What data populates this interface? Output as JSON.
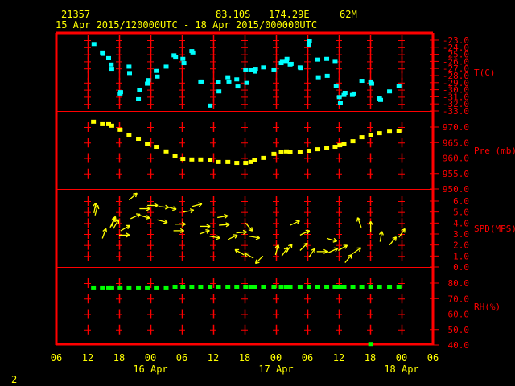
{
  "header": {
    "station": "21357",
    "latitude": "83.10S",
    "longitude": "174.29E",
    "elevation": "62M",
    "period": "15 Apr 2015/120000UTC - 18 Apr 2015/000000UTC"
  },
  "page_number": "2",
  "colors": {
    "frame": "#ff0000",
    "text": "#ffff00",
    "temperature": "#00ffff",
    "pressure": "#ffff00",
    "wind": "#ffff00",
    "rh": "#00ff00"
  },
  "chart_data": {
    "type": "scatter",
    "title": "21357 83.10S 174.29E 62M",
    "subtitle": "15 Apr 2015/120000UTC - 18 Apr 2015/000000UTC",
    "x_units": "hours since 15 Apr 2015 06UTC",
    "x_range": [
      0,
      72
    ],
    "x_tick_labels": [
      "06",
      "12",
      "18",
      "00",
      "06",
      "12",
      "18",
      "00",
      "06",
      "12",
      "18",
      "00",
      "06"
    ],
    "date_labels": [
      {
        "label": "16 Apr",
        "hour": 18
      },
      {
        "label": "17 Apr",
        "hour": 42
      },
      {
        "label": "18 Apr",
        "hour": 66
      }
    ],
    "grid": true,
    "panels": [
      {
        "name": "temperature",
        "label": "T(C)",
        "range": [
          -33,
          -23
        ],
        "tick_labels": [
          "-23.0",
          "-24.0",
          "-25.0",
          "-26.0",
          "-27.0",
          "-28.0",
          "-29.0",
          "-30.0",
          "-31.0",
          "-32.0",
          "-33.0"
        ],
        "points": [
          [
            7.2,
            -23.6
          ],
          [
            8.8,
            -24.8
          ],
          [
            8.9,
            -25.0
          ],
          [
            10.0,
            -25.6
          ],
          [
            10.5,
            -26.5
          ],
          [
            10.6,
            -27.1
          ],
          [
            12.3,
            -30.4
          ],
          [
            12.2,
            -30.6
          ],
          [
            13.9,
            -26.8
          ],
          [
            14.0,
            -27.7
          ],
          [
            15.9,
            -30.1
          ],
          [
            15.7,
            -31.4
          ],
          [
            17.6,
            -28.7
          ],
          [
            17.4,
            -29.2
          ],
          [
            19.1,
            -27.4
          ],
          [
            19.3,
            -28.2
          ],
          [
            21.0,
            -26.8
          ],
          [
            22.5,
            -25.2
          ],
          [
            22.8,
            -25.4
          ],
          [
            24.2,
            -25.7
          ],
          [
            24.4,
            -26.3
          ],
          [
            25.9,
            -24.6
          ],
          [
            26.1,
            -24.8
          ],
          [
            27.6,
            -28.9
          ],
          [
            27.8,
            -28.9
          ],
          [
            29.4,
            -32.3
          ],
          [
            31.0,
            -29.0
          ],
          [
            31.1,
            -30.3
          ],
          [
            32.8,
            -28.3
          ],
          [
            33.0,
            -28.9
          ],
          [
            34.5,
            -28.6
          ],
          [
            34.7,
            -29.6
          ],
          [
            36.2,
            -27.2
          ],
          [
            36.4,
            -29.1
          ],
          [
            37.2,
            -27.3
          ],
          [
            38.0,
            -27.5
          ],
          [
            38.1,
            -27.1
          ],
          [
            39.6,
            -26.9
          ],
          [
            41.6,
            -27.2
          ],
          [
            43.0,
            -26.3
          ],
          [
            43.2,
            -26.0
          ],
          [
            44.0,
            -26.0
          ],
          [
            44.1,
            -25.7
          ],
          [
            44.7,
            -26.5
          ],
          [
            44.9,
            -26.4
          ],
          [
            46.6,
            -26.9
          ],
          [
            46.7,
            -27.0
          ],
          [
            48.3,
            -23.7
          ],
          [
            48.4,
            -23.2
          ],
          [
            50.0,
            -25.8
          ],
          [
            50.1,
            -28.3
          ],
          [
            51.7,
            -25.7
          ],
          [
            51.8,
            -28.1
          ],
          [
            53.3,
            -26.0
          ],
          [
            53.5,
            -29.5
          ],
          [
            54.1,
            -31.1
          ],
          [
            54.3,
            -31.9
          ],
          [
            55.0,
            -30.8
          ],
          [
            55.2,
            -30.5
          ],
          [
            56.6,
            -30.8
          ],
          [
            56.9,
            -30.6
          ],
          [
            58.4,
            -28.8
          ],
          [
            60.1,
            -28.9
          ],
          [
            60.3,
            -29.2
          ],
          [
            61.8,
            -31.3
          ],
          [
            62.0,
            -31.5
          ],
          [
            63.7,
            -30.3
          ],
          [
            65.5,
            -29.5
          ]
        ]
      },
      {
        "name": "pressure",
        "label": "Pre (mb)",
        "range": [
          950,
          970
        ],
        "tick_labels": [
          "970.0",
          "965.0",
          "960.0",
          "955.0",
          "950.0"
        ],
        "points": [
          [
            7.1,
            971.6
          ],
          [
            8.8,
            970.8
          ],
          [
            10.0,
            970.8
          ],
          [
            10.6,
            970.3
          ],
          [
            12.2,
            969.0
          ],
          [
            13.9,
            967.4
          ],
          [
            15.7,
            966.1
          ],
          [
            17.4,
            964.5
          ],
          [
            19.1,
            963.5
          ],
          [
            21.0,
            962.0
          ],
          [
            22.7,
            960.4
          ],
          [
            24.2,
            959.6
          ],
          [
            25.9,
            959.4
          ],
          [
            27.6,
            959.4
          ],
          [
            29.4,
            959.1
          ],
          [
            31.0,
            958.6
          ],
          [
            32.8,
            958.6
          ],
          [
            34.5,
            958.3
          ],
          [
            36.2,
            958.3
          ],
          [
            37.2,
            958.6
          ],
          [
            37.9,
            959.1
          ],
          [
            39.6,
            959.9
          ],
          [
            41.6,
            961.2
          ],
          [
            43.0,
            961.7
          ],
          [
            44.0,
            962.0
          ],
          [
            44.7,
            961.7
          ],
          [
            46.6,
            961.7
          ],
          [
            48.3,
            962.2
          ],
          [
            50.0,
            962.7
          ],
          [
            51.7,
            963.0
          ],
          [
            53.3,
            963.5
          ],
          [
            54.2,
            964.0
          ],
          [
            55.0,
            964.3
          ],
          [
            56.7,
            965.3
          ],
          [
            58.4,
            966.6
          ],
          [
            60.1,
            967.4
          ],
          [
            61.8,
            967.9
          ],
          [
            63.7,
            968.4
          ],
          [
            65.5,
            968.7
          ]
        ]
      },
      {
        "name": "wind",
        "label": "SPD(MPS)",
        "range": [
          0,
          6
        ],
        "tick_labels": [
          "6.0",
          "5.0",
          "4.0",
          "3.0",
          "2.0",
          "1.0",
          "0.0"
        ],
        "arrows_note": "each: [hour, speed, direction_deg (0=right,90=up)]",
        "arrows": [
          [
            7.2,
            4.9,
            80
          ],
          [
            7.4,
            4.7,
            75
          ],
          [
            8.8,
            2.6,
            70
          ],
          [
            10.3,
            3.6,
            65
          ],
          [
            10.6,
            3.7,
            70
          ],
          [
            10.9,
            3.5,
            60
          ],
          [
            12.3,
            3.3,
            30
          ],
          [
            12.0,
            2.9,
            0
          ],
          [
            13.9,
            6.1,
            40
          ],
          [
            14.2,
            4.4,
            25
          ],
          [
            15.9,
            5.3,
            0
          ],
          [
            15.9,
            4.7,
            -15
          ],
          [
            17.4,
            5.6,
            0
          ],
          [
            19.5,
            5.5,
            -5
          ],
          [
            21.0,
            5.5,
            -15
          ],
          [
            19.3,
            4.3,
            -15
          ],
          [
            24.3,
            5.0,
            10
          ],
          [
            25.9,
            5.5,
            15
          ],
          [
            22.7,
            3.9,
            0
          ],
          [
            22.4,
            3.3,
            0
          ],
          [
            27.4,
            3.7,
            0
          ],
          [
            27.4,
            3.0,
            20
          ],
          [
            29.3,
            2.8,
            -10
          ],
          [
            30.8,
            4.5,
            10
          ],
          [
            31.1,
            3.8,
            5
          ],
          [
            32.8,
            2.5,
            25
          ],
          [
            34.4,
            3.1,
            5
          ],
          [
            36.2,
            4.0,
            -50
          ],
          [
            36.9,
            2.8,
            -10
          ],
          [
            35.9,
            1.1,
            150
          ],
          [
            37.7,
            0.8,
            150
          ],
          [
            39.5,
            1.0,
            225
          ],
          [
            41.9,
            1.1,
            75
          ],
          [
            43.1,
            1.0,
            55
          ],
          [
            43.9,
            1.3,
            55
          ],
          [
            44.7,
            3.8,
            25
          ],
          [
            46.6,
            2.9,
            25
          ],
          [
            46.6,
            1.5,
            45
          ],
          [
            48.3,
            0.9,
            55
          ],
          [
            49.8,
            1.4,
            0
          ],
          [
            51.7,
            2.6,
            -15
          ],
          [
            52.0,
            1.3,
            25
          ],
          [
            53.9,
            1.5,
            30
          ],
          [
            55.2,
            0.4,
            50
          ],
          [
            56.6,
            1.2,
            35
          ],
          [
            58.3,
            3.6,
            110
          ],
          [
            60.1,
            3.2,
            90
          ],
          [
            61.9,
            2.3,
            80
          ],
          [
            63.7,
            2.0,
            50
          ],
          [
            65.5,
            2.7,
            55
          ]
        ]
      },
      {
        "name": "relative-humidity",
        "label": "RH(%)",
        "range": [
          40,
          80
        ],
        "tick_labels": [
          "80.0",
          "70.0",
          "60.0",
          "50.0",
          "40.0"
        ],
        "points": [
          [
            7.1,
            76.4
          ],
          [
            8.8,
            76.4
          ],
          [
            10.0,
            76.4
          ],
          [
            10.6,
            76.4
          ],
          [
            12.2,
            76.4
          ],
          [
            13.9,
            76.4
          ],
          [
            15.7,
            76.4
          ],
          [
            17.4,
            76.4
          ],
          [
            19.1,
            76.4
          ],
          [
            21.0,
            76.4
          ],
          [
            22.7,
            77.4
          ],
          [
            24.2,
            77.4
          ],
          [
            25.9,
            77.4
          ],
          [
            27.6,
            77.4
          ],
          [
            29.4,
            77.4
          ],
          [
            31.0,
            77.4
          ],
          [
            32.8,
            77.4
          ],
          [
            34.5,
            77.4
          ],
          [
            36.2,
            77.4
          ],
          [
            37.2,
            77.4
          ],
          [
            37.9,
            77.4
          ],
          [
            39.6,
            77.4
          ],
          [
            41.6,
            77.4
          ],
          [
            43.0,
            77.4
          ],
          [
            44.0,
            77.4
          ],
          [
            44.7,
            77.4
          ],
          [
            46.6,
            77.4
          ],
          [
            48.3,
            77.4
          ],
          [
            50.0,
            77.4
          ],
          [
            51.7,
            77.4
          ],
          [
            53.3,
            77.4
          ],
          [
            54.1,
            77.4
          ],
          [
            55.0,
            77.4
          ],
          [
            56.7,
            77.4
          ],
          [
            58.4,
            77.4
          ],
          [
            60.1,
            77.4
          ],
          [
            60.1,
            40.4
          ],
          [
            61.8,
            77.4
          ],
          [
            63.7,
            77.4
          ],
          [
            65.5,
            77.4
          ]
        ]
      }
    ]
  }
}
